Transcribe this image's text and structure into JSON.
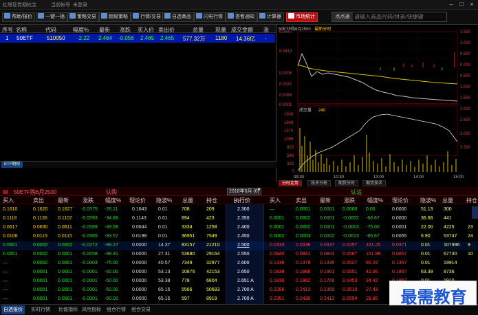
{
  "titlebar": {
    "app": "红塔证券期权宝",
    "account": "当前帐号",
    "login": "未登录"
  },
  "toolbar": {
    "buttons": [
      "帮助/报价",
      "一键一插",
      "策略交易",
      "超级策略",
      "行情/交易",
      "自选商品",
      "闪电行情",
      "查看通知",
      "计算器",
      "市场统计"
    ],
    "search_btn": "点点通",
    "search_placeholder": "请输入商品代码/拼音/快捷键"
  },
  "watchlist": {
    "columns": [
      "序号",
      "名称",
      "代码",
      "幅度%",
      "最新",
      "涨跌",
      "买入价",
      "卖出价",
      "总量",
      "现量",
      "成交金额",
      "涨"
    ],
    "row": [
      "1",
      "50ETF",
      "510050",
      "-2.22",
      "2.464",
      "-0.056",
      "2.465",
      "2.465",
      "577.32万",
      "1180",
      "14.36亿",
      "-"
    ],
    "tab": "ETF期权"
  },
  "chart": {
    "header": "50ETF购6月2500",
    "legend": "最新分时",
    "price_axis": [
      "0.0547",
      "0.0413",
      "0.0206",
      "0.0137",
      "0.0068",
      "0.0001"
    ],
    "vol_title": "成交量",
    "vol_value": "240",
    "vol_axis": [
      "1936",
      "1648",
      "1370",
      "1096",
      "823",
      "548",
      "323",
      "0"
    ],
    "x_axis": [
      "09:30",
      "10:30",
      "13:00",
      "14:00",
      "15:00"
    ],
    "right_axis": [
      "1.500",
      "1.000",
      "0.500",
      "0.000",
      "0.500",
      "1.000",
      "1.500",
      "2.000",
      "2.500",
      "3.000",
      "3.500"
    ],
    "tabs": [
      "分时走势",
      "技术分析",
      "期货分时",
      "期货技术"
    ],
    "chart_data": {
      "type": "line",
      "x": [
        "09:30",
        "10:30",
        "13:00",
        "14:00",
        "15:00"
      ],
      "series": [],
      "ylim": [
        0.0001,
        0.0547
      ]
    }
  },
  "tquote": {
    "title": "50ETF购6月2500",
    "call_label": "认购",
    "put_label": "认沽",
    "month": "2018年6月 (0)",
    "call_cols": [
      "买入",
      "卖出",
      "最新",
      "涨跌",
      "幅度%",
      "理论价",
      "隐波%",
      "总量",
      "持仓"
    ],
    "mid_col": "执行价",
    "put_cols": [
      "买入",
      "卖出",
      "最新",
      "涨跌",
      "幅度%",
      "理论价",
      "隐波%",
      "总量",
      "持仓"
    ],
    "rows": [
      {
        "call": [
          "0.1610",
          "0.1620",
          "0.1627",
          "-0.0575",
          "-26.11",
          "0.1643",
          "0.01",
          "708",
          "209"
        ],
        "strike": "2.300",
        "put": [
          "—",
          "0.0001",
          "0.0001",
          "0.0000",
          "0.00",
          "0.0000",
          "51.13",
          "300",
          ""
        ]
      },
      {
        "call": [
          "0.1118",
          "0.1135",
          "0.1107",
          "-0.0593",
          "-34.88",
          "0.1143",
          "0.01",
          "894",
          "423"
        ],
        "strike": "2.350",
        "put": [
          "0.0001",
          "0.0002",
          "0.0001",
          "-0.0002",
          "-66.67",
          "0.0000",
          "36.66",
          "441",
          ""
        ]
      },
      {
        "call": [
          "0.0617",
          "0.0630",
          "0.0611",
          "-0.0589",
          "-49.08",
          "0.0644",
          "0.01",
          "3334",
          "1258"
        ],
        "strike": "2.400",
        "put": [
          "0.0001",
          "0.0002",
          "0.0001",
          "-0.0003",
          "-75.00",
          "0.0001",
          "22.00",
          "4225",
          "23"
        ]
      },
      {
        "call": [
          "0.0106",
          "0.0115",
          "0.0115",
          "-0.0585",
          "-83.57",
          "0.0198",
          "0.01",
          "36951",
          "7549"
        ],
        "strike": "2.450",
        "put": [
          "0.0002",
          "0.0003",
          "0.0002",
          "-0.0013",
          "-86.67",
          "0.0055",
          "6.90",
          "53747",
          "24"
        ]
      },
      {
        "call": [
          "0.0001",
          "0.0002",
          "0.0002",
          "-0.0272",
          "-99.27",
          "0.0000",
          "14.37",
          "83157",
          "21210"
        ],
        "strike": "2.500",
        "put": [
          "0.0333",
          "0.0336",
          "0.0337",
          "0.0257",
          "321.25",
          "0.0371",
          "0.01",
          "107996",
          "9"
        ]
      },
      {
        "call": [
          "0.0001",
          "0.0002",
          "0.0001",
          "-0.0058",
          "-98.31",
          "0.0000",
          "27.31",
          "53680",
          "29164"
        ],
        "strike": "2.550",
        "put": [
          "0.0840",
          "0.0841",
          "0.0841",
          "0.0587",
          "151.88",
          "0.0857",
          "0.01",
          "67730",
          "10"
        ]
      },
      {
        "call": [
          "—",
          "0.0002",
          "0.0001",
          "-0.0003",
          "-75.00",
          "0.0000",
          "40.57",
          "7349",
          "32977"
        ],
        "strike": "2.600",
        "put": [
          "0.1336",
          "0.1378",
          "0.1335",
          "0.0527",
          "65.22",
          "0.1357",
          "0.01",
          "19914",
          ""
        ]
      },
      {
        "call": [
          "—",
          "0.0001",
          "0.0001",
          "-0.0001",
          "-50.00",
          "0.0000",
          "53.13",
          "10876",
          "42153"
        ],
        "strike": "2.650",
        "put": [
          "0.1839",
          "0.1868",
          "0.1861",
          "0.0551",
          "42.06",
          "0.1857",
          "63.39",
          "8736",
          ""
        ]
      },
      {
        "call": [
          "—",
          "0.0001",
          "0.0001",
          "-0.0001",
          "-50.00",
          "0.0000",
          "53.38",
          "778",
          "6804"
        ],
        "strike": "2.651 A",
        "put": [
          "0.1830",
          "0.1862",
          "0.1769",
          "0.0453",
          "34.42",
          "0.1867",
          "0.01",
          "1910",
          ""
        ]
      },
      {
        "call": [
          "—",
          "0.0001",
          "0.0001",
          "-0.0001",
          "-50.00",
          "0.0000",
          "65.15",
          "5566",
          "50693"
        ],
        "strike": "2.700 A",
        "put": [
          "0.2356",
          "0.2413",
          "0.2369",
          "0.0510",
          "27.43",
          "0.2357",
          "90.24",
          "9973",
          ""
        ]
      },
      {
        "call": [
          "—",
          "0.0001",
          "0.0001",
          "-0.0001",
          "-50.00",
          "0.0000",
          "65.15",
          "597",
          "8919"
        ],
        "strike": "2.700 A",
        "put": [
          "0.2351",
          "0.2430",
          "0.2413",
          "0.0554",
          "29.80",
          "0.2350",
          "",
          "",
          ""
        ]
      },
      {
        "call": [
          "—",
          "0.0001",
          "0.0001",
          "-0.0001",
          "-50.00",
          "0.0000",
          "76.58",
          "165",
          "5694"
        ],
        "strike": "2.749 A",
        "put": [
          "0.2835",
          "0.2889",
          "0.2834",
          "0.0530",
          "22.90",
          "",
          "",
          "",
          ""
        ]
      }
    ]
  },
  "statusbar": {
    "tabs": [
      "自选报价",
      "实时行情",
      "比值指标",
      "风险指标",
      "组仓行情",
      "组合交易"
    ]
  },
  "watermark": {
    "text": "最需教育"
  }
}
